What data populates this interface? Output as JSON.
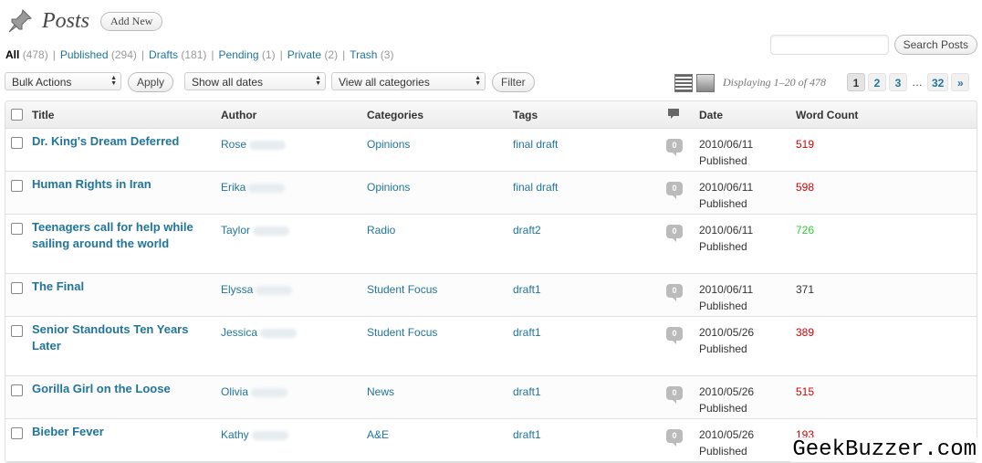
{
  "header": {
    "title": "Posts",
    "add_new_label": "Add New"
  },
  "filters": [
    {
      "label": "All",
      "count": "(478)",
      "current": true
    },
    {
      "label": "Published",
      "count": "(294)"
    },
    {
      "label": "Drafts",
      "count": "(181)"
    },
    {
      "label": "Pending",
      "count": "(1)"
    },
    {
      "label": "Private",
      "count": "(2)"
    },
    {
      "label": "Trash",
      "count": "(3)"
    }
  ],
  "search": {
    "button_label": "Search Posts",
    "value": ""
  },
  "tablenav": {
    "bulk_actions": "Bulk Actions",
    "apply_label": "Apply",
    "dates": "Show all dates",
    "categories": "View all categories",
    "filter_label": "Filter",
    "displaying": "Displaying 1–20 of 478",
    "pages": [
      "1",
      "2",
      "3",
      "…",
      "32",
      "»"
    ],
    "current_page": "1"
  },
  "columns": {
    "title": "Title",
    "author": "Author",
    "categories": "Categories",
    "tags": "Tags",
    "date": "Date",
    "word_count": "Word Count"
  },
  "posts": [
    {
      "title": "Dr. King's Dream Deferred",
      "author": "Rose",
      "category": "Opinions",
      "tags": "final draft",
      "comments": "0",
      "date": "2010/06/11",
      "status": "Published",
      "word_count": "519",
      "wc_color": "red"
    },
    {
      "title": "Human Rights in Iran",
      "author": "Erika",
      "category": "Opinions",
      "tags": "final draft",
      "comments": "0",
      "date": "2010/06/11",
      "status": "Published",
      "word_count": "598",
      "wc_color": "red"
    },
    {
      "title": "Teenagers call for help while sailing around the world",
      "author": "Taylor",
      "category": "Radio",
      "tags": "draft2",
      "comments": "0",
      "date": "2010/06/11",
      "status": "Published",
      "word_count": "726",
      "wc_color": "green"
    },
    {
      "title": "The Final",
      "author": "Elyssa",
      "category": "Student Focus",
      "tags": "draft1",
      "comments": "0",
      "date": "2010/06/11",
      "status": "Published",
      "word_count": "371",
      "wc_color": "black"
    },
    {
      "title": "Senior Standouts Ten Years Later",
      "author": "Jessica",
      "category": "Student Focus",
      "tags": "draft1",
      "comments": "0",
      "date": "2010/05/26",
      "status": "Published",
      "word_count": "389",
      "wc_color": "red"
    },
    {
      "title": "Gorilla Girl on the Loose",
      "author": "Olivia",
      "category": "News",
      "tags": "draft1",
      "comments": "0",
      "date": "2010/05/26",
      "status": "Published",
      "word_count": "515",
      "wc_color": "red"
    },
    {
      "title": "Bieber Fever",
      "author": "Kathy",
      "category": "A&E",
      "tags": "draft1",
      "comments": "0",
      "date": "2010/05/26",
      "status": "Published",
      "word_count": "193",
      "wc_color": "red"
    }
  ],
  "watermark": "GeekBuzzer.com"
}
